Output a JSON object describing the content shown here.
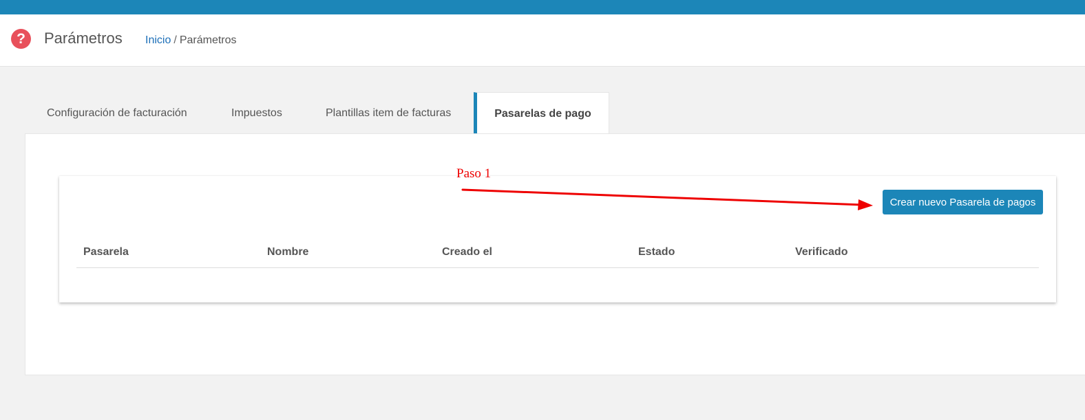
{
  "header": {
    "title": "Parámetros",
    "breadcrumb": {
      "home": "Inicio",
      "separator": "/",
      "current": "Parámetros"
    },
    "help_icon": "question-circle-icon"
  },
  "tabs": [
    {
      "label": "Configuración de facturación",
      "active": false
    },
    {
      "label": "Impuestos",
      "active": false
    },
    {
      "label": "Plantillas item de facturas",
      "active": false
    },
    {
      "label": "Pasarelas de pago",
      "active": true
    }
  ],
  "annotation": {
    "label": "Paso 1",
    "color": "#ee0000"
  },
  "card": {
    "create_button": "Crear nuevo Pasarela de pagos",
    "table": {
      "columns": [
        "Pasarela",
        "Nombre",
        "Creado el",
        "Estado",
        "Verificado"
      ],
      "rows": []
    }
  },
  "colors": {
    "accent": "#1c86b8",
    "help_icon": "#e8505b",
    "link": "#1c6fb8"
  }
}
